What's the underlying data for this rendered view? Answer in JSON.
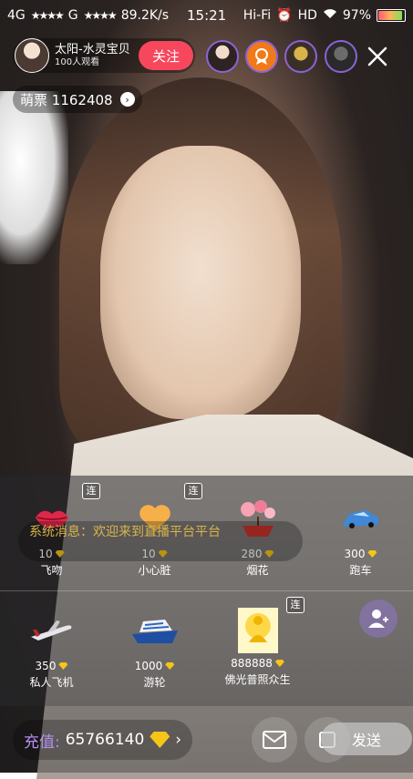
{
  "status_bar": {
    "network_left": "4G",
    "network_right": "G",
    "speed": "89.2K/s",
    "time": "15:21",
    "audio": "Hi-Fi",
    "hd": "HD",
    "battery": "97%"
  },
  "anchor": {
    "name": "太阳-水灵宝贝",
    "viewers": "100人观看",
    "follow_label": "关注"
  },
  "votes": {
    "label": "萌票",
    "value": "1162408"
  },
  "system_message": "系统消息：欢迎来到直播平台平台",
  "gifts": [
    {
      "name": "飞吻",
      "price": "10",
      "icon": "kiss-lips-icon"
    },
    {
      "name": "小心脏",
      "price": "10",
      "icon": "heart-icon",
      "combo": "连"
    },
    {
      "name": "烟花",
      "price": "280",
      "icon": "fireworks-icon",
      "combo": "连"
    },
    {
      "name": "跑车",
      "price": "300",
      "icon": "sports-car-icon"
    },
    {
      "name": "私人飞机",
      "price": "350",
      "icon": "private-jet-icon"
    },
    {
      "name": "游轮",
      "price": "1000",
      "icon": "cruise-ship-icon"
    },
    {
      "name": "佛光普照众生",
      "price": "888888",
      "icon": "buddha-light-icon",
      "combo": "连"
    }
  ],
  "bottom": {
    "recharge_label": "充值:",
    "balance": "65766140",
    "send_label": "发送"
  }
}
